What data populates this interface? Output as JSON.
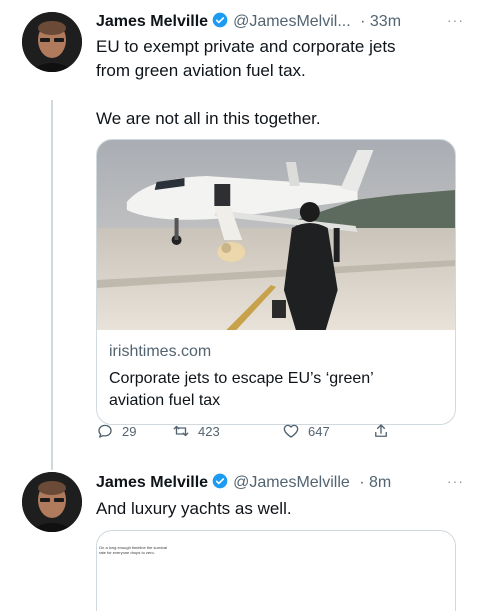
{
  "tweet1": {
    "name": "James Melville",
    "handle": "@JamesMelvil...",
    "time": "33m",
    "text_line1": "EU to exempt private and corporate jets",
    "text_line2": "from green aviation fuel tax.",
    "text_line3": "We are not all in this together.",
    "more": "···",
    "card": {
      "domain": "irishtimes.com",
      "title_line1": "Corporate jets to escape EU’s ‘green’",
      "title_line2": "aviation fuel tax"
    },
    "actions": {
      "replies": "29",
      "retweets": "423",
      "likes": "647"
    }
  },
  "tweet2": {
    "name": "James Melville",
    "handle": "@JamesMelville",
    "time": "8m",
    "text": "And luxury yachts as well.",
    "more": "···",
    "card_caption_line1": "On a long enough timeline the survival",
    "card_caption_line2": "rate for everyone drops to zero."
  },
  "colors": {
    "verified": "#1d9bf0",
    "text": "#0f1419",
    "secondary": "#536471",
    "border": "#cfd9de"
  }
}
